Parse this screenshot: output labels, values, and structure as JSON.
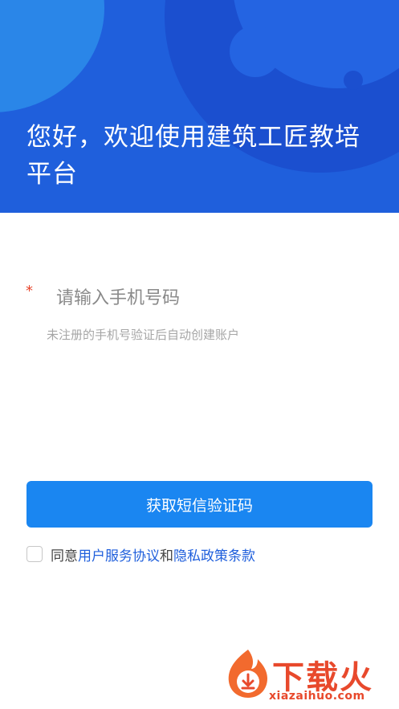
{
  "header": {
    "title": "您好，欢迎使用建筑工匠教培平台"
  },
  "form": {
    "required_mark": "*",
    "phone_placeholder": "请输入手机号码",
    "hint": "未注册的手机号验证后自动创建账户"
  },
  "actions": {
    "get_code_label": "获取短信验证码"
  },
  "agreement": {
    "prefix": "同意",
    "user_agreement": "用户服务协议",
    "conjunction": "和",
    "privacy_policy": "隐私政策条款"
  },
  "watermark": {
    "brand": "下载火",
    "domain": "xiazaihuo.com"
  },
  "colors": {
    "header_bg": "#1f5fdc",
    "button_bg": "#1a86f1",
    "link": "#1f5fdc",
    "required": "#e8452c",
    "watermark": "#e8492c"
  }
}
